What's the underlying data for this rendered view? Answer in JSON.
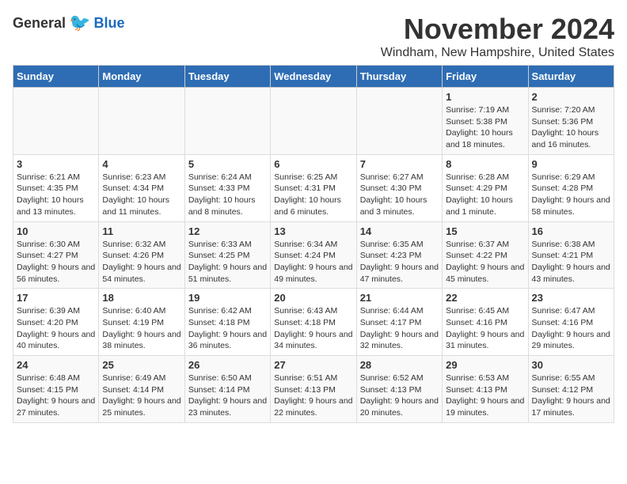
{
  "logo": {
    "general": "General",
    "blue": "Blue"
  },
  "title": "November 2024",
  "subtitle": "Windham, New Hampshire, United States",
  "days_of_week": [
    "Sunday",
    "Monday",
    "Tuesday",
    "Wednesday",
    "Thursday",
    "Friday",
    "Saturday"
  ],
  "weeks": [
    [
      {
        "day": "",
        "info": ""
      },
      {
        "day": "",
        "info": ""
      },
      {
        "day": "",
        "info": ""
      },
      {
        "day": "",
        "info": ""
      },
      {
        "day": "",
        "info": ""
      },
      {
        "day": "1",
        "info": "Sunrise: 7:19 AM\nSunset: 5:38 PM\nDaylight: 10 hours and 18 minutes."
      },
      {
        "day": "2",
        "info": "Sunrise: 7:20 AM\nSunset: 5:36 PM\nDaylight: 10 hours and 16 minutes."
      }
    ],
    [
      {
        "day": "3",
        "info": "Sunrise: 6:21 AM\nSunset: 4:35 PM\nDaylight: 10 hours and 13 minutes."
      },
      {
        "day": "4",
        "info": "Sunrise: 6:23 AM\nSunset: 4:34 PM\nDaylight: 10 hours and 11 minutes."
      },
      {
        "day": "5",
        "info": "Sunrise: 6:24 AM\nSunset: 4:33 PM\nDaylight: 10 hours and 8 minutes."
      },
      {
        "day": "6",
        "info": "Sunrise: 6:25 AM\nSunset: 4:31 PM\nDaylight: 10 hours and 6 minutes."
      },
      {
        "day": "7",
        "info": "Sunrise: 6:27 AM\nSunset: 4:30 PM\nDaylight: 10 hours and 3 minutes."
      },
      {
        "day": "8",
        "info": "Sunrise: 6:28 AM\nSunset: 4:29 PM\nDaylight: 10 hours and 1 minute."
      },
      {
        "day": "9",
        "info": "Sunrise: 6:29 AM\nSunset: 4:28 PM\nDaylight: 9 hours and 58 minutes."
      }
    ],
    [
      {
        "day": "10",
        "info": "Sunrise: 6:30 AM\nSunset: 4:27 PM\nDaylight: 9 hours and 56 minutes."
      },
      {
        "day": "11",
        "info": "Sunrise: 6:32 AM\nSunset: 4:26 PM\nDaylight: 9 hours and 54 minutes."
      },
      {
        "day": "12",
        "info": "Sunrise: 6:33 AM\nSunset: 4:25 PM\nDaylight: 9 hours and 51 minutes."
      },
      {
        "day": "13",
        "info": "Sunrise: 6:34 AM\nSunset: 4:24 PM\nDaylight: 9 hours and 49 minutes."
      },
      {
        "day": "14",
        "info": "Sunrise: 6:35 AM\nSunset: 4:23 PM\nDaylight: 9 hours and 47 minutes."
      },
      {
        "day": "15",
        "info": "Sunrise: 6:37 AM\nSunset: 4:22 PM\nDaylight: 9 hours and 45 minutes."
      },
      {
        "day": "16",
        "info": "Sunrise: 6:38 AM\nSunset: 4:21 PM\nDaylight: 9 hours and 43 minutes."
      }
    ],
    [
      {
        "day": "17",
        "info": "Sunrise: 6:39 AM\nSunset: 4:20 PM\nDaylight: 9 hours and 40 minutes."
      },
      {
        "day": "18",
        "info": "Sunrise: 6:40 AM\nSunset: 4:19 PM\nDaylight: 9 hours and 38 minutes."
      },
      {
        "day": "19",
        "info": "Sunrise: 6:42 AM\nSunset: 4:18 PM\nDaylight: 9 hours and 36 minutes."
      },
      {
        "day": "20",
        "info": "Sunrise: 6:43 AM\nSunset: 4:18 PM\nDaylight: 9 hours and 34 minutes."
      },
      {
        "day": "21",
        "info": "Sunrise: 6:44 AM\nSunset: 4:17 PM\nDaylight: 9 hours and 32 minutes."
      },
      {
        "day": "22",
        "info": "Sunrise: 6:45 AM\nSunset: 4:16 PM\nDaylight: 9 hours and 31 minutes."
      },
      {
        "day": "23",
        "info": "Sunrise: 6:47 AM\nSunset: 4:16 PM\nDaylight: 9 hours and 29 minutes."
      }
    ],
    [
      {
        "day": "24",
        "info": "Sunrise: 6:48 AM\nSunset: 4:15 PM\nDaylight: 9 hours and 27 minutes."
      },
      {
        "day": "25",
        "info": "Sunrise: 6:49 AM\nSunset: 4:14 PM\nDaylight: 9 hours and 25 minutes."
      },
      {
        "day": "26",
        "info": "Sunrise: 6:50 AM\nSunset: 4:14 PM\nDaylight: 9 hours and 23 minutes."
      },
      {
        "day": "27",
        "info": "Sunrise: 6:51 AM\nSunset: 4:13 PM\nDaylight: 9 hours and 22 minutes."
      },
      {
        "day": "28",
        "info": "Sunrise: 6:52 AM\nSunset: 4:13 PM\nDaylight: 9 hours and 20 minutes."
      },
      {
        "day": "29",
        "info": "Sunrise: 6:53 AM\nSunset: 4:13 PM\nDaylight: 9 hours and 19 minutes."
      },
      {
        "day": "30",
        "info": "Sunrise: 6:55 AM\nSunset: 4:12 PM\nDaylight: 9 hours and 17 minutes."
      }
    ]
  ]
}
